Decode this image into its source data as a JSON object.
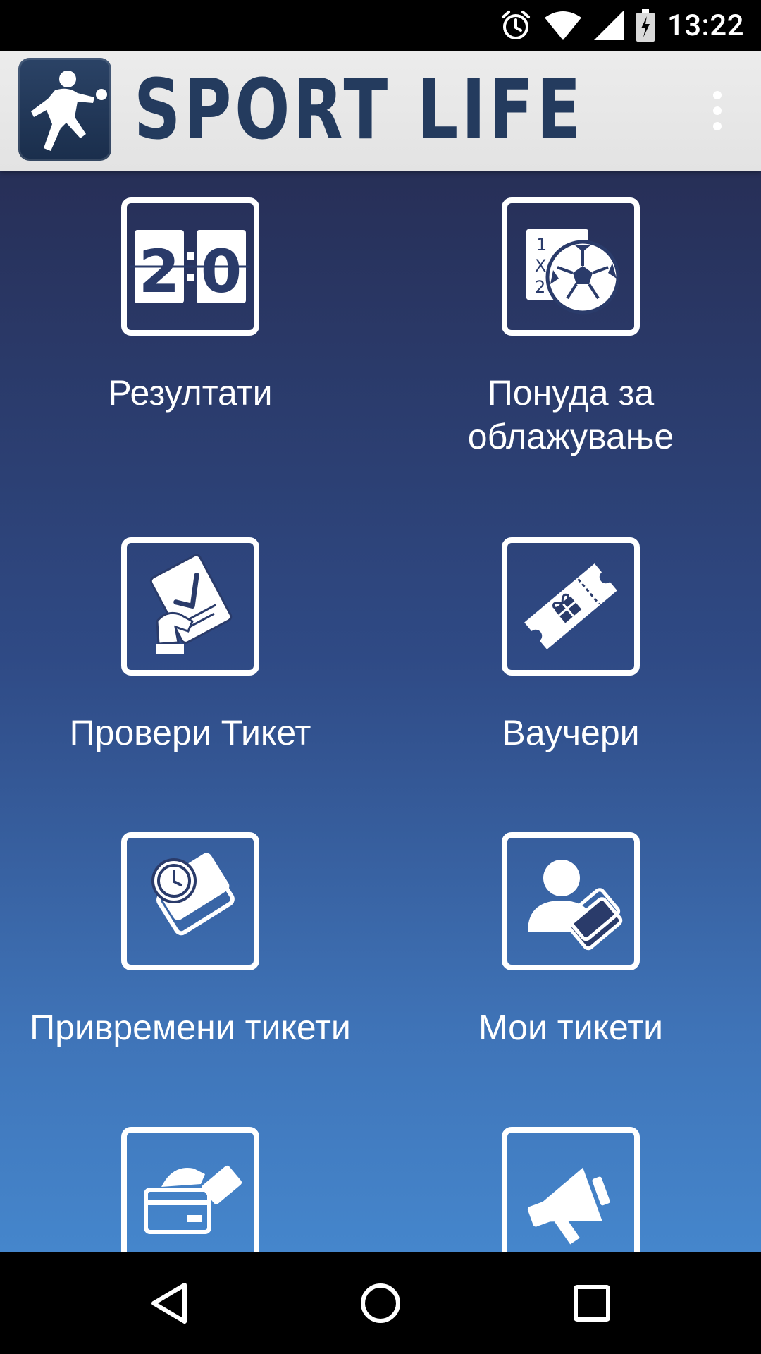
{
  "status_bar": {
    "time": "13:22",
    "icons": [
      "alarm-icon",
      "wifi-icon",
      "signal-icon",
      "battery-charging-icon"
    ]
  },
  "app_bar": {
    "logo_text": "SPORT LIFE",
    "logo_icon": "football-player-icon",
    "menu_icon": "overflow-menu-icon",
    "bg_color": "#e6e6e6",
    "logo_color": "#243b5e"
  },
  "menu": {
    "items": [
      {
        "label": "Резултати",
        "icon": "scoreboard-icon",
        "score_left": "2",
        "score_right": "0"
      },
      {
        "label": "Понуда за\nоблажување",
        "icon": "betting-offer-icon",
        "odds": [
          "1",
          "X",
          "2"
        ]
      },
      {
        "label": "Провери Тикет",
        "icon": "check-ticket-icon"
      },
      {
        "label": "Ваучери",
        "icon": "voucher-icon"
      },
      {
        "label": "Привремени тикети",
        "icon": "temporary-tickets-icon"
      },
      {
        "label": "Мои тикети",
        "icon": "my-tickets-icon"
      },
      {
        "label": "",
        "icon": "payment-card-icon"
      },
      {
        "label": "",
        "icon": "megaphone-icon"
      }
    ]
  },
  "nav_bar": {
    "icons": [
      "back-icon",
      "home-icon",
      "recents-icon"
    ]
  },
  "colors": {
    "gradient_top": "#272f57",
    "gradient_bottom": "#4586cc",
    "tile_stroke": "#ffffff"
  }
}
